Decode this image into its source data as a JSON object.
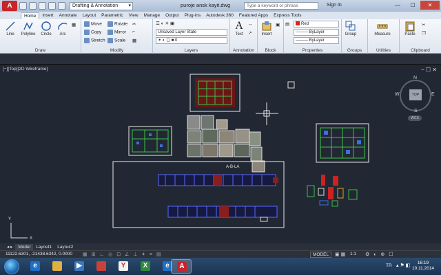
{
  "titlebar": {
    "workspace": "Drafting & Annotation",
    "document_title": "puroje ansk kayit.dwg",
    "search_placeholder": "Type a keyword or phrase",
    "sign_in": "Sign In",
    "minimize": "—",
    "maximize": "☐",
    "close": "✕"
  },
  "tabs": [
    "Home",
    "Insert",
    "Annotate",
    "Layout",
    "Parametric",
    "View",
    "Manage",
    "Output",
    "Plug-ins",
    "Autodesk 360",
    "Featured Apps",
    "Express Tools"
  ],
  "ribbon": {
    "draw": {
      "title": "Draw",
      "line": "Line",
      "polyline": "Polyline",
      "circle": "Circle",
      "arc": "Arc"
    },
    "modify": {
      "title": "Modify",
      "move": "Move",
      "rotate": "Rotate",
      "copy": "Copy",
      "mirror": "Mirror",
      "stretch": "Stretch",
      "scale": "Scale"
    },
    "layers": {
      "title": "Layers",
      "layer_state": "Unsaved Layer State",
      "current_layer": "0"
    },
    "annotation": {
      "title": "Annotation",
      "text": "Text"
    },
    "block": {
      "title": "Block",
      "insert": "Insert"
    },
    "properties": {
      "title": "Properties",
      "color": "Red",
      "linetype": "ByLayer",
      "lineweight": "ByLayer"
    },
    "groups": {
      "title": "Groups",
      "group": "Group"
    },
    "utilities": {
      "title": "Utilities",
      "measure": "Measure"
    },
    "clipboard": {
      "title": "Clipboard",
      "paste": "Paste"
    }
  },
  "viewport": {
    "label": "[−][Top][2D Wireframe]",
    "controls": "− ☐ ✕",
    "viewcube_face": "TOP",
    "compass": {
      "n": "N",
      "s": "S",
      "e": "E",
      "w": "W"
    },
    "wcs": "WCS",
    "drawing_annotation": "A-B-LA"
  },
  "layout_tabs": [
    "Model",
    "Layout1",
    "Layout2"
  ],
  "status": {
    "coords": "11122.6301, -21438.6342, 0.0000",
    "model": "MODEL",
    "scale": "1:1"
  },
  "taskbar": {
    "tray": "TR",
    "time": "16:19",
    "date": "10.11.2014"
  },
  "colors": {
    "title_bar": "#b7c8dd",
    "canvas": "#222833",
    "accent_red": "#c8242b"
  }
}
